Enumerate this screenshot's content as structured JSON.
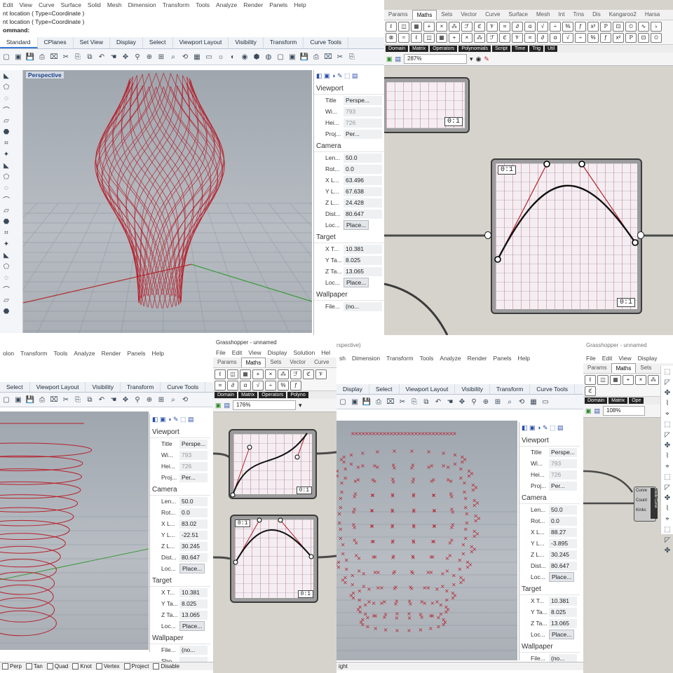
{
  "top_left": {
    "menu_items": [
      "Edit",
      "View",
      "Curve",
      "Surface",
      "Solid",
      "Mesh",
      "Dimension",
      "Transform",
      "Tools",
      "Analyze",
      "Render",
      "Panels",
      "Help"
    ],
    "command_history": [
      "nt location ( Type=Coordinate )",
      "nt location ( Type=Coordinate )"
    ],
    "command_prompt": "ommand:",
    "tabs": [
      "Standard",
      "CPlanes",
      "Set View",
      "Display",
      "Select",
      "Viewport Layout",
      "Visibility",
      "Transform",
      "Curve Tools"
    ],
    "active_tab": "Standard",
    "viewport_label": "Perspective",
    "props": {
      "viewport": {
        "title": "Viewport",
        "rows": [
          [
            "Title",
            "Perspe..."
          ],
          [
            "Wi...",
            "793"
          ],
          [
            "Hei...",
            "726"
          ],
          [
            "Proj...",
            "Per..."
          ]
        ]
      },
      "camera": {
        "title": "Camera",
        "rows": [
          [
            "Len...",
            "50.0"
          ],
          [
            "Rot...",
            "0.0"
          ],
          [
            "X L...",
            "63.496"
          ],
          [
            "Y L...",
            "67.638"
          ],
          [
            "Z L...",
            "24.428"
          ],
          [
            "Dist...",
            "80.647"
          ],
          [
            "Loc...",
            "Place..."
          ]
        ]
      },
      "target": {
        "title": "Target",
        "rows": [
          [
            "X T...",
            "10.381"
          ],
          [
            "Y Ta...",
            "8.025"
          ],
          [
            "Z Ta...",
            "13.065"
          ],
          [
            "Loc...",
            "Place..."
          ]
        ]
      },
      "wallpaper": {
        "title": "Wallpaper",
        "rows": [
          [
            "File...",
            "(no..."
          ]
        ]
      }
    }
  },
  "top_right": {
    "tabs": [
      "Params",
      "Maths",
      "Sets",
      "Vector",
      "Curve",
      "Surface",
      "Mesh",
      "Int",
      "Trns",
      "Dis",
      "Kangaroo2",
      "Harsa"
    ],
    "active_tab": "Maths",
    "categories": [
      "Domain",
      "Matrix",
      "Operators",
      "Polynomials",
      "Script",
      "Time",
      "Trig",
      "Util"
    ],
    "zoom": "287%",
    "graph_label_tl": "0:1",
    "graph_label_br": "0:1",
    "top_graph_label": "0:1"
  },
  "bottom_left": {
    "menu_items": [
      "olon",
      "Transform",
      "Tools",
      "Analyze",
      "Render",
      "Panels",
      "Help"
    ],
    "tabs": [
      "Select",
      "Viewport Layout",
      "Visibility",
      "Transform",
      "Curve Tools"
    ],
    "props": {
      "viewport": {
        "title": "Viewport",
        "rows": [
          [
            "Title",
            "Perspe..."
          ],
          [
            "Wi...",
            "793"
          ],
          [
            "Hei...",
            "726"
          ],
          [
            "Proj...",
            "Per..."
          ]
        ]
      },
      "camera": {
        "title": "Camera",
        "rows": [
          [
            "Len...",
            "50.0"
          ],
          [
            "Rot...",
            "0.0"
          ],
          [
            "X L...",
            "83.02"
          ],
          [
            "Y L...",
            "-22.51"
          ],
          [
            "Z L...",
            "30.245"
          ],
          [
            "Dist...",
            "80.647"
          ],
          [
            "Loc...",
            "Place..."
          ]
        ]
      },
      "target": {
        "title": "Target",
        "rows": [
          [
            "X T...",
            "10.381"
          ],
          [
            "Y Ta...",
            "8.025"
          ],
          [
            "Z Ta...",
            "13.065"
          ],
          [
            "Loc...",
            "Place..."
          ]
        ]
      },
      "wallpaper": {
        "title": "Wallpaper",
        "rows": [
          [
            "File...",
            "(no..."
          ],
          [
            "Sho...",
            ""
          ]
        ]
      }
    },
    "status": [
      "Perp",
      "Tan",
      "Quad",
      "Knot",
      "Vertex",
      "Project",
      "Disable"
    ]
  },
  "bottom_mid": {
    "title": "Grasshopper - unnamed",
    "menu_items": [
      "File",
      "Edit",
      "View",
      "Display",
      "Solution",
      "Hel"
    ],
    "tabs": [
      "Params",
      "Maths",
      "Sets",
      "Vector",
      "Curve",
      "Su"
    ],
    "active_tab": "Maths",
    "categories": [
      "Domain",
      "Matrix",
      "Operators",
      "Polyno"
    ],
    "zoom": "176%",
    "graph1_label": "0:1",
    "graph2_label_tl": "0:1",
    "graph2_label_br": "0:1"
  },
  "bottom_right": {
    "title_fragment": "rspective)",
    "menu_items": [
      "sh",
      "Dimension",
      "Transform",
      "Tools",
      "Analyze",
      "Render",
      "Panels",
      "Help"
    ],
    "tabs": [
      "Display",
      "Select",
      "Viewport Layout",
      "Visibility",
      "Transform",
      "Curve Tools"
    ],
    "props": {
      "viewport": {
        "title": "Viewport",
        "rows": [
          [
            "Title",
            "Perspe..."
          ],
          [
            "Wi...",
            "793"
          ],
          [
            "Hei...",
            "726"
          ],
          [
            "Proj...",
            "Per..."
          ]
        ]
      },
      "camera": {
        "title": "Camera",
        "rows": [
          [
            "Len...",
            "50.0"
          ],
          [
            "Rot...",
            "0.0"
          ],
          [
            "X L...",
            "88.27"
          ],
          [
            "Y L...",
            "-3.895"
          ],
          [
            "Z L...",
            "30.245"
          ],
          [
            "Dist...",
            "80.647"
          ],
          [
            "Loc...",
            "Place..."
          ]
        ]
      },
      "target": {
        "title": "Target",
        "rows": [
          [
            "X T...",
            "10.381"
          ],
          [
            "Y Ta...",
            "8.025"
          ],
          [
            "Z Ta...",
            "13.065"
          ],
          [
            "Loc...",
            "Place..."
          ]
        ]
      },
      "wallpaper": {
        "title": "Wallpaper",
        "rows": [
          [
            "File...",
            "(no..."
          ]
        ]
      }
    },
    "status_left": "ight",
    "gh_title": "Grasshopper - unnamed",
    "gh_menu": [
      "File",
      "Edit",
      "View",
      "Display"
    ],
    "gh_tabs": [
      "Params",
      "Maths",
      "Sets"
    ],
    "gh_zoom": "108%",
    "gh_categories": [
      "Domain",
      "Matrix",
      "Ope"
    ],
    "node_inputs": [
      "Curve",
      "Count",
      "Kinks"
    ],
    "node_name": "Divide Curve"
  },
  "colors": {
    "accent": "#3a7bd5",
    "curve_red": "#b5212d",
    "gh_canvas": "#d5d3cb",
    "viewport_bg": "#a9afb5"
  }
}
